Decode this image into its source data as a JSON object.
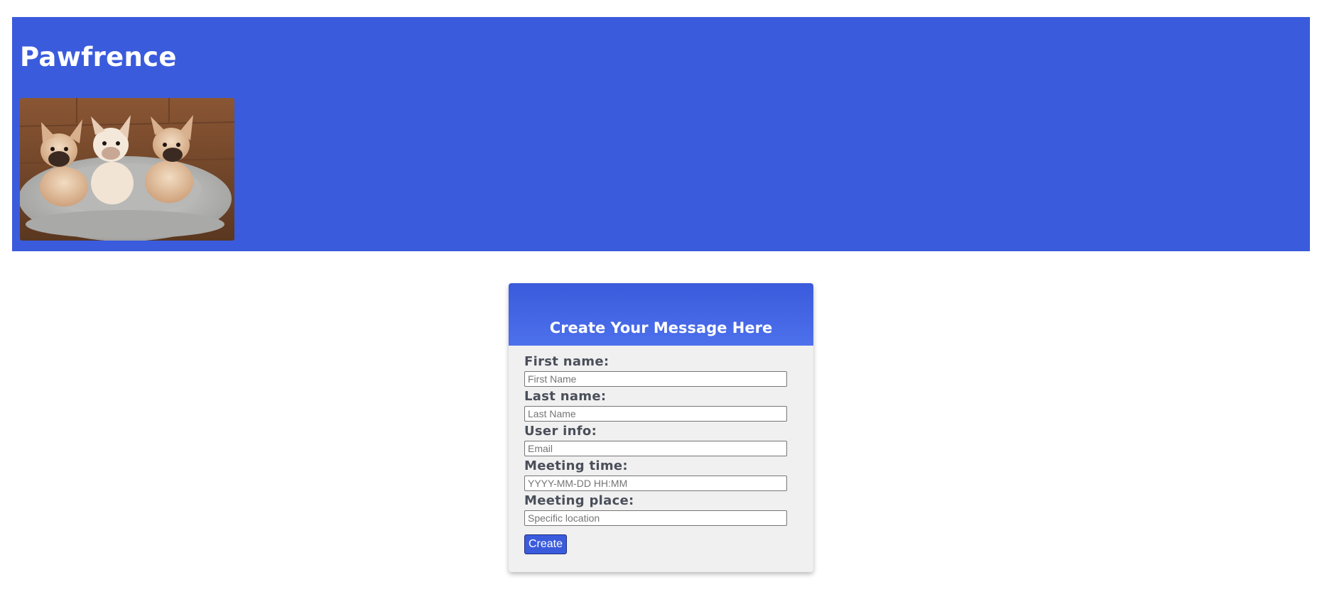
{
  "header": {
    "title": "Pawfrence",
    "image_subject": "three French bulldog puppies in a grey pet bed",
    "background_color": "#3a5bdc"
  },
  "form": {
    "title": "Create Your Message Here",
    "fields": {
      "first_name": {
        "label": "First name:",
        "placeholder": "First Name",
        "value": ""
      },
      "last_name": {
        "label": "Last name:",
        "placeholder": "Last Name",
        "value": ""
      },
      "user_info": {
        "label": "User info:",
        "placeholder": "Email",
        "value": ""
      },
      "meeting_time": {
        "label": "Meeting time:",
        "placeholder": "YYYY-MM-DD HH:MM",
        "value": ""
      },
      "meeting_place": {
        "label": "Meeting place:",
        "placeholder": "Specific location",
        "value": ""
      }
    },
    "submit_label": "Create",
    "accent_color": "#3a5bdc"
  }
}
